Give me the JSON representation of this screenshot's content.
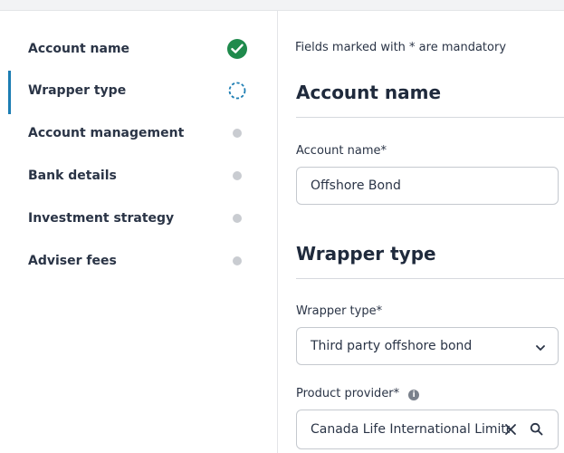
{
  "sidebar": {
    "steps": [
      {
        "label": "Account name",
        "status": "complete"
      },
      {
        "label": "Wrapper type",
        "status": "current"
      },
      {
        "label": "Account management",
        "status": "pending"
      },
      {
        "label": "Bank details",
        "status": "pending"
      },
      {
        "label": "Investment strategy",
        "status": "pending"
      },
      {
        "label": "Adviser fees",
        "status": "pending"
      }
    ]
  },
  "main": {
    "mandatory_note": "Fields marked with * are mandatory",
    "account_section": {
      "title": "Account name",
      "field_label": "Account name",
      "required_marker": "*",
      "value": "Offshore Bond"
    },
    "wrapper_section": {
      "title": "Wrapper type",
      "wrapper_label": "Wrapper type",
      "wrapper_required": "*",
      "wrapper_value": "Third party offshore bond",
      "provider_label": "Product provider",
      "provider_required": "*",
      "provider_info_icon": "i",
      "provider_value": "Canada Life International Limited"
    }
  },
  "icons": {
    "complete": "check-circle-icon",
    "current": "dashed-circle-icon",
    "pending": "dot-icon",
    "chevron": "chevron-down-icon",
    "clear": "clear-icon",
    "search": "search-icon",
    "info": "info-icon"
  },
  "colors": {
    "complete_green": "#1f8a4c",
    "active_blue": "#1c7db3",
    "pending_grey": "#c9ccd1"
  }
}
